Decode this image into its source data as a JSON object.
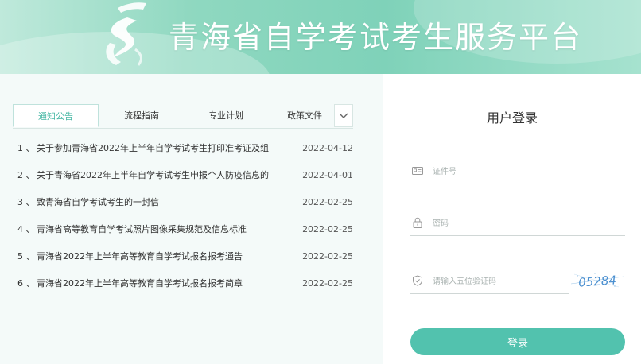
{
  "header": {
    "site_title": "青海省自学考试考生服务平台"
  },
  "tabs": [
    {
      "label": "通知公告",
      "active": true
    },
    {
      "label": "流程指南",
      "active": false
    },
    {
      "label": "专业计划",
      "active": false
    },
    {
      "label": "政策文件",
      "active": false
    }
  ],
  "news": [
    {
      "num": "1 、",
      "title": "关于参加青海省2022年上半年自学考试考生打印准考证及组",
      "date": "2022-04-12"
    },
    {
      "num": "2 、",
      "title": "关于青海省2022年上半年自学考试考生申报个人防疫信息的",
      "date": "2022-04-01"
    },
    {
      "num": "3 、",
      "title": "致青海省自学考试考生的一封信",
      "date": "2022-02-25"
    },
    {
      "num": "4 、",
      "title": "青海省高等教育自学考试照片图像采集规范及信息标准",
      "date": "2022-02-25"
    },
    {
      "num": "5 、",
      "title": "青海省2022年上半年高等教育自学考试报名报考通告",
      "date": "2022-02-25"
    },
    {
      "num": "6 、",
      "title": "青海省2022年上半年高等教育自学考试报名报考简章",
      "date": "2022-02-25"
    }
  ],
  "login": {
    "title": "用户登录",
    "id_placeholder": "证件号",
    "password_placeholder": "密码",
    "captcha_placeholder": "请输入五位验证码",
    "captcha_code": "05284",
    "submit_label": "登录"
  },
  "colors": {
    "accent": "#52c2ae",
    "tab_active": "#49b8a5",
    "header_bg": "#8fd8c0"
  },
  "icons": {
    "logo": "qinghai-selfexam-logo",
    "tab_more": "chevron-down-icon",
    "id_field": "id-card-icon",
    "password_field": "lock-icon",
    "captcha_field": "shield-check-icon"
  }
}
